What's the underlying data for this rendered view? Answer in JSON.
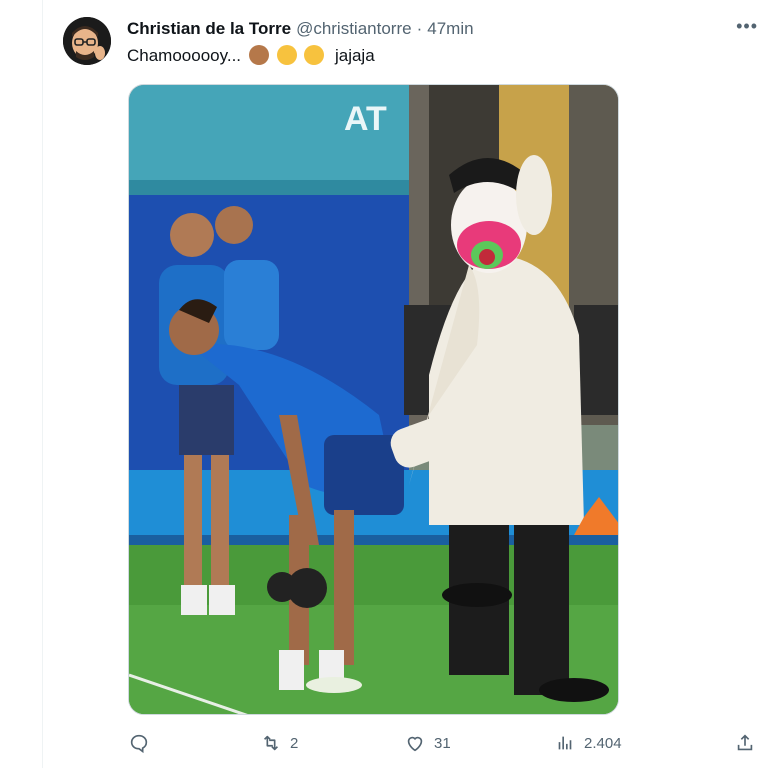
{
  "tweet": {
    "author_name": "Christian de la Torre",
    "handle": "@christiantorre",
    "separator": "·",
    "time": "47min",
    "text": "Chamoooooy...",
    "text_suffix": "jajaja",
    "emojis": [
      "see-no-evil-monkey",
      "face-with-tears-of-joy",
      "zany-face"
    ],
    "more_label": "•••"
  },
  "actions": {
    "reply_count": "",
    "retweet_count": "2",
    "like_count": "31",
    "views_count": "2.404"
  },
  "colors": {
    "text_primary": "#0f1419",
    "text_secondary": "#536471",
    "border": "#cfd9de"
  }
}
